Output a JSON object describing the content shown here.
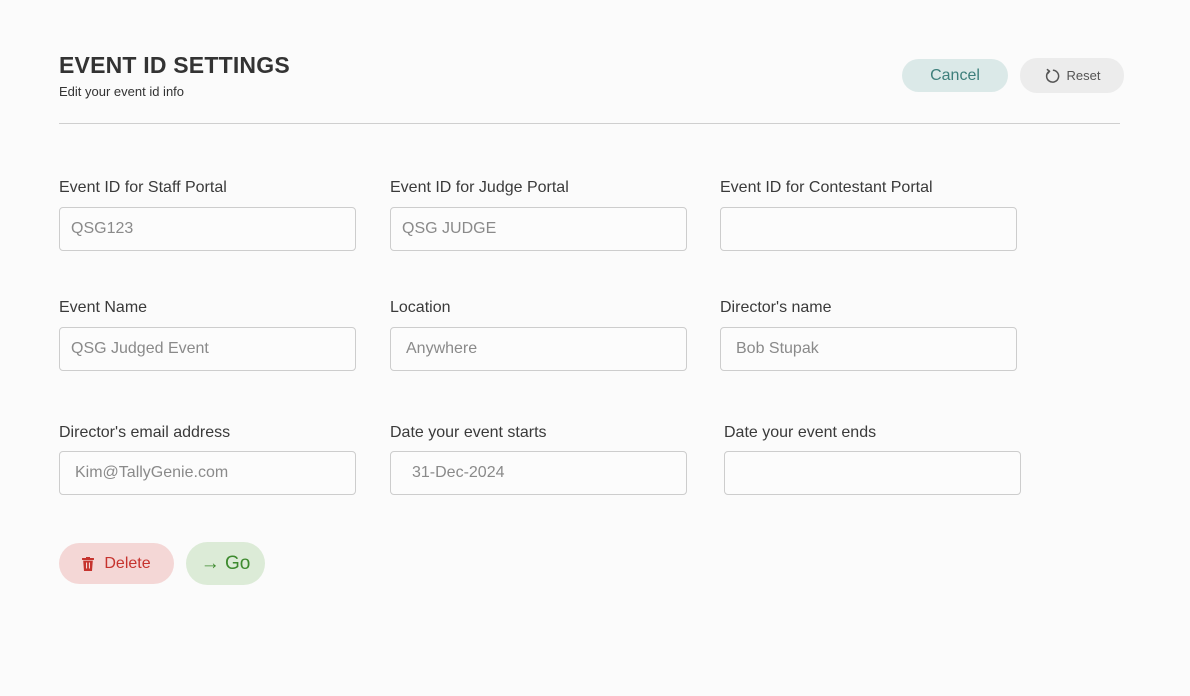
{
  "header": {
    "title": "EVENT ID SETTINGS",
    "subtitle": "Edit your event id info"
  },
  "actions": {
    "cancel_label": "Cancel",
    "reset_label": "Reset",
    "reset_icon": "reset-icon",
    "delete_label": "Delete",
    "delete_icon": "trash-icon",
    "go_label": "→ Go"
  },
  "fields": {
    "staff_portal_id": {
      "label": "Event ID for Staff Portal",
      "value": "",
      "placeholder": "QSG123"
    },
    "judge_portal_id": {
      "label": "Event ID for Judge Portal",
      "value": "",
      "placeholder": "QSG JUDGE"
    },
    "contestant_portal_id": {
      "label": "Event ID for Contestant Portal",
      "value": "",
      "placeholder": ""
    },
    "event_name": {
      "label": "Event Name",
      "value": "",
      "placeholder": "QSG Judged Event"
    },
    "location": {
      "label": "Location",
      "value": "",
      "placeholder": "Anywhere"
    },
    "director_name": {
      "label": "Director's name",
      "value": "",
      "placeholder": "Bob Stupak"
    },
    "director_email": {
      "label": "Director's email address",
      "value": "",
      "placeholder": "Kim@TallyGenie.com"
    },
    "start_date": {
      "label": "Date your event starts",
      "value": "",
      "placeholder": "31-Dec-2024"
    },
    "end_date": {
      "label": "Date your event ends",
      "value": "",
      "placeholder": ""
    }
  },
  "colors": {
    "cancel_bg": "#dbe9e8",
    "cancel_text": "#3d7f7b",
    "reset_bg": "#ececec",
    "delete_bg": "#f4d7d6",
    "delete_text": "#c6332e",
    "go_bg": "#dcebd7",
    "go_text": "#3d8a2e"
  }
}
